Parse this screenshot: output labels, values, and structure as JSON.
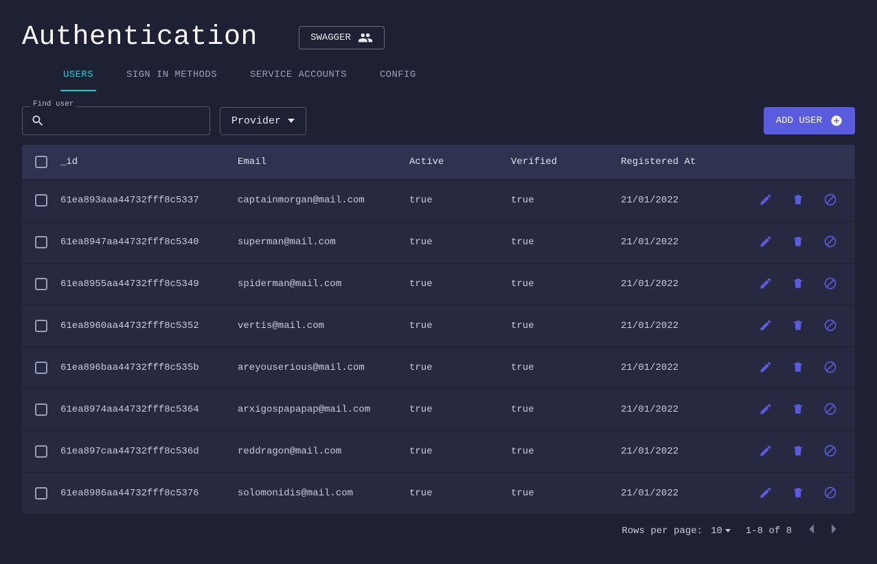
{
  "title": "Authentication",
  "swagger_label": "SWAGGER",
  "tabs": {
    "users": "USERS",
    "signin": "SIGN IN METHODS",
    "service": "SERVICE ACCOUNTS",
    "config": "CONFIG"
  },
  "toolbar": {
    "find_label": "Find user",
    "find_value": "",
    "provider_label": "Provider",
    "add_user_label": "ADD USER"
  },
  "columns": {
    "id": "_id",
    "email": "Email",
    "active": "Active",
    "verified": "Verified",
    "registered": "Registered At"
  },
  "rows": [
    {
      "id": "61ea893aaa44732fff8c5337",
      "email": "captainmorgan@mail.com",
      "active": "true",
      "verified": "true",
      "registered": "21/01/2022"
    },
    {
      "id": "61ea8947aa44732fff8c5340",
      "email": "superman@mail.com",
      "active": "true",
      "verified": "true",
      "registered": "21/01/2022"
    },
    {
      "id": "61ea8955aa44732fff8c5349",
      "email": "spiderman@mail.com",
      "active": "true",
      "verified": "true",
      "registered": "21/01/2022"
    },
    {
      "id": "61ea8960aa44732fff8c5352",
      "email": "vertis@mail.com",
      "active": "true",
      "verified": "true",
      "registered": "21/01/2022"
    },
    {
      "id": "61ea896baa44732fff8c535b",
      "email": "areyouserious@mail.com",
      "active": "true",
      "verified": "true",
      "registered": "21/01/2022"
    },
    {
      "id": "61ea8974aa44732fff8c5364",
      "email": "arxigospapapap@mail.com",
      "active": "true",
      "verified": "true",
      "registered": "21/01/2022"
    },
    {
      "id": "61ea897caa44732fff8c536d",
      "email": "reddragon@mail.com",
      "active": "true",
      "verified": "true",
      "registered": "21/01/2022"
    },
    {
      "id": "61ea8986aa44732fff8c5376",
      "email": "solomonidis@mail.com",
      "active": "true",
      "verified": "true",
      "registered": "21/01/2022"
    }
  ],
  "pagination": {
    "rows_per_page_label": "Rows per page:",
    "rows_per_page_value": "10",
    "range": "1-8 of 8"
  },
  "action_icons": {
    "edit": "edit-icon",
    "delete": "delete-icon",
    "block": "block-icon"
  }
}
